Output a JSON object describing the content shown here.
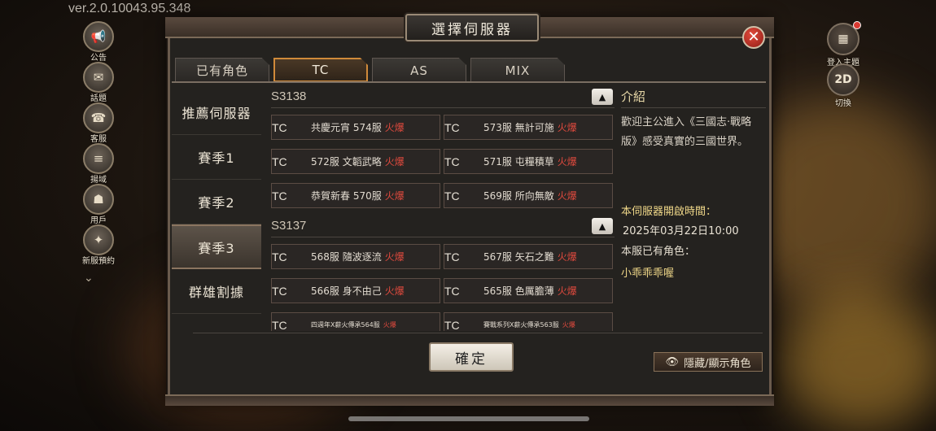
{
  "version": "ver.2.0.10043.95.348",
  "left_side_buttons": [
    {
      "label": "公告",
      "icon": "horn-icon"
    },
    {
      "label": "話題",
      "icon": "chat-icon"
    },
    {
      "label": "客服",
      "icon": "support-icon"
    },
    {
      "label": "揚域",
      "icon": "banner-icon"
    },
    {
      "label": "用戶",
      "icon": "user-icon"
    },
    {
      "label": "新服預約",
      "icon": "reserve-icon"
    }
  ],
  "right_side_buttons": [
    {
      "label": "登入主題",
      "icon_text": "▦"
    },
    {
      "label": "切換",
      "icon_text": "2D"
    }
  ],
  "dialog": {
    "title": "選擇伺服器",
    "close_glyph": "✕",
    "tabs": [
      "已有角色",
      "TC",
      "AS",
      "MIX"
    ],
    "active_tab": "TC",
    "menu": [
      "推薦伺服器",
      "賽季1",
      "賽季2",
      "賽季3",
      "群雄割據"
    ],
    "active_menu": "賽季3",
    "sections": [
      {
        "title": "S3138",
        "servers": [
          {
            "region": "TC",
            "name": "共慶元宵 574服",
            "status": "火爆"
          },
          {
            "region": "TC",
            "name": "573服 無計可施",
            "status": "火爆"
          },
          {
            "region": "TC",
            "name": "572服 文韜武略",
            "status": "火爆"
          },
          {
            "region": "TC",
            "name": "571服 屯糧積草",
            "status": "火爆"
          },
          {
            "region": "TC",
            "name": "恭賀新春 570服",
            "status": "火爆"
          },
          {
            "region": "TC",
            "name": "569服 所向無敵",
            "status": "火爆"
          }
        ]
      },
      {
        "title": "S3137",
        "servers": [
          {
            "region": "TC",
            "name": "568服 隨波逐流",
            "status": "火爆"
          },
          {
            "region": "TC",
            "name": "567服 矢石之難",
            "status": "火爆"
          },
          {
            "region": "TC",
            "name": "566服 身不由己",
            "status": "火爆"
          },
          {
            "region": "TC",
            "name": "565服 色厲膽薄",
            "status": "火爆"
          },
          {
            "region": "TC",
            "name": "四週年X薪火傳承564服",
            "status": "火爆"
          },
          {
            "region": "TC",
            "name": "賽戰系列X薪火傳承563服",
            "status": "火爆"
          }
        ]
      }
    ],
    "info": {
      "heading": "介紹",
      "intro": "歡迎主公進入《三國志·戰略版》感受真實的三國世界。",
      "open_time_label": "本伺服器開啟時間：",
      "open_time": "2025年03月22日10:00",
      "have_char_label": "本服已有角色：",
      "char_name": "小乖乖乖喔"
    },
    "confirm_label": "確定",
    "toggle_label": "隱藏/顯示角色"
  }
}
